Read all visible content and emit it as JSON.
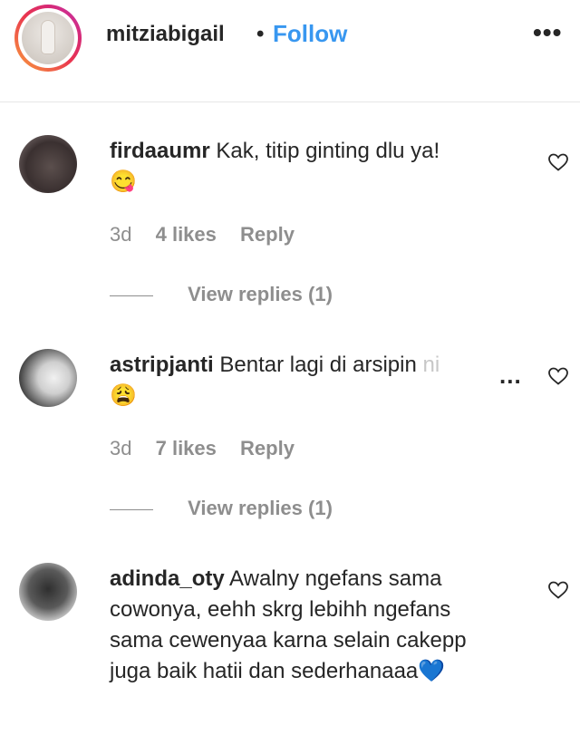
{
  "header": {
    "username": "mitziabigail",
    "separator": "•",
    "follow_label": "Follow",
    "more_label": "•••"
  },
  "comments": [
    {
      "username": "firdaaumr",
      "text": "Kak, titip ginting dlu ya!",
      "emoji": "😋",
      "time": "3d",
      "likes": "4 likes",
      "reply_label": "Reply",
      "view_replies": "View replies (1)"
    },
    {
      "username": "astripjanti",
      "text": "Bentar lagi di arsipin",
      "truncated_tail": "ni",
      "more_label": "...",
      "emoji": "😩",
      "time": "3d",
      "likes": "7 likes",
      "reply_label": "Reply",
      "view_replies": "View replies (1)"
    },
    {
      "username": "adinda_oty",
      "text": "Awalny ngefans sama cowonya, eehh skrg lebihh ngefans sama cewenyaa karna selain cakepp juga baik hatii dan sederhanaaa",
      "emoji": "💙"
    }
  ],
  "icons": {
    "heart": "heart-outline-icon",
    "more": "more-horizontal-icon"
  },
  "colors": {
    "follow_blue": "#3897f0",
    "text": "#262626",
    "secondary": "#8e8e8e"
  }
}
